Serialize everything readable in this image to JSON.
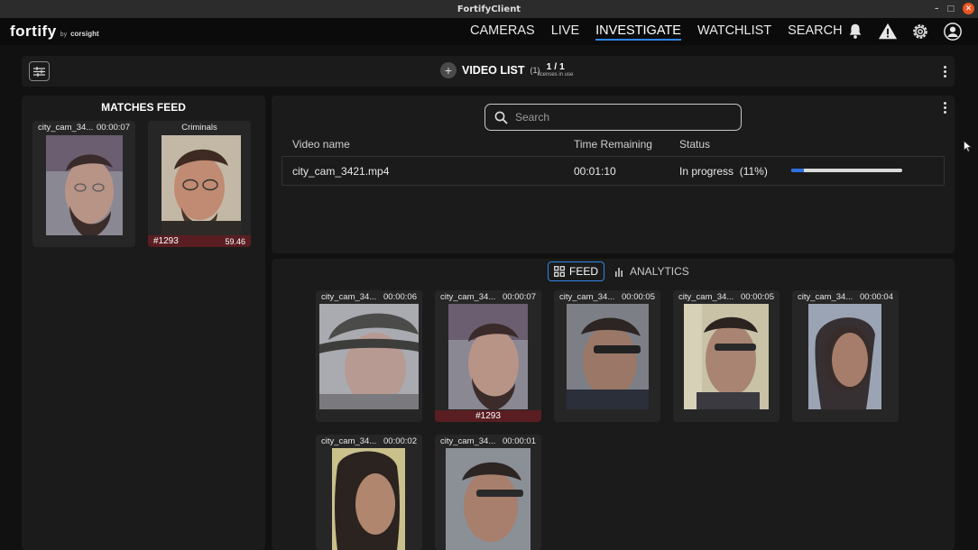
{
  "window": {
    "title": "FortifyClient"
  },
  "brand": {
    "name": "fortify",
    "by": "by",
    "partner": "corsight"
  },
  "nav": {
    "items": [
      "CAMERAS",
      "LIVE",
      "INVESTIGATE",
      "WATCHLIST",
      "SEARCH"
    ],
    "active": "INVESTIGATE"
  },
  "toolbar": {
    "title": "VIDEO LIST",
    "count": "(1)",
    "licenses": "1 / 1",
    "licenses_label": "licenses in use"
  },
  "matches_feed": {
    "title": "MATCHES FEED",
    "detection": {
      "name": "city_cam_34...",
      "time": "00:00:07"
    },
    "match": {
      "watchlist": "Criminals",
      "id": "#1293",
      "score": "59.46"
    }
  },
  "video_list": {
    "search_placeholder": "Search",
    "columns": [
      "Video name",
      "Time Remaining",
      "Status"
    ],
    "rows": [
      {
        "name": "city_cam_3421.mp4",
        "remaining": "00:01:10",
        "status": "In progress",
        "percent_label": "(11%)",
        "progress": 0.11
      }
    ]
  },
  "feed": {
    "tabs": [
      "FEED",
      "ANALYTICS"
    ],
    "active_tab": "FEED",
    "items": [
      {
        "name": "city_cam_34...",
        "time": "00:00:06"
      },
      {
        "name": "city_cam_34...",
        "time": "00:00:07",
        "match_id": "#1293"
      },
      {
        "name": "city_cam_34...",
        "time": "00:00:05"
      },
      {
        "name": "city_cam_34...",
        "time": "00:00:05"
      },
      {
        "name": "city_cam_34...",
        "time": "00:00:04"
      },
      {
        "name": "city_cam_34...",
        "time": "00:00:02"
      },
      {
        "name": "city_cam_34...",
        "time": "00:00:01"
      }
    ]
  },
  "colors": {
    "accent": "#2f86e6",
    "match_bar": "#5a1e22",
    "panel": "#1b1b1b",
    "close_button": "#e95420"
  }
}
